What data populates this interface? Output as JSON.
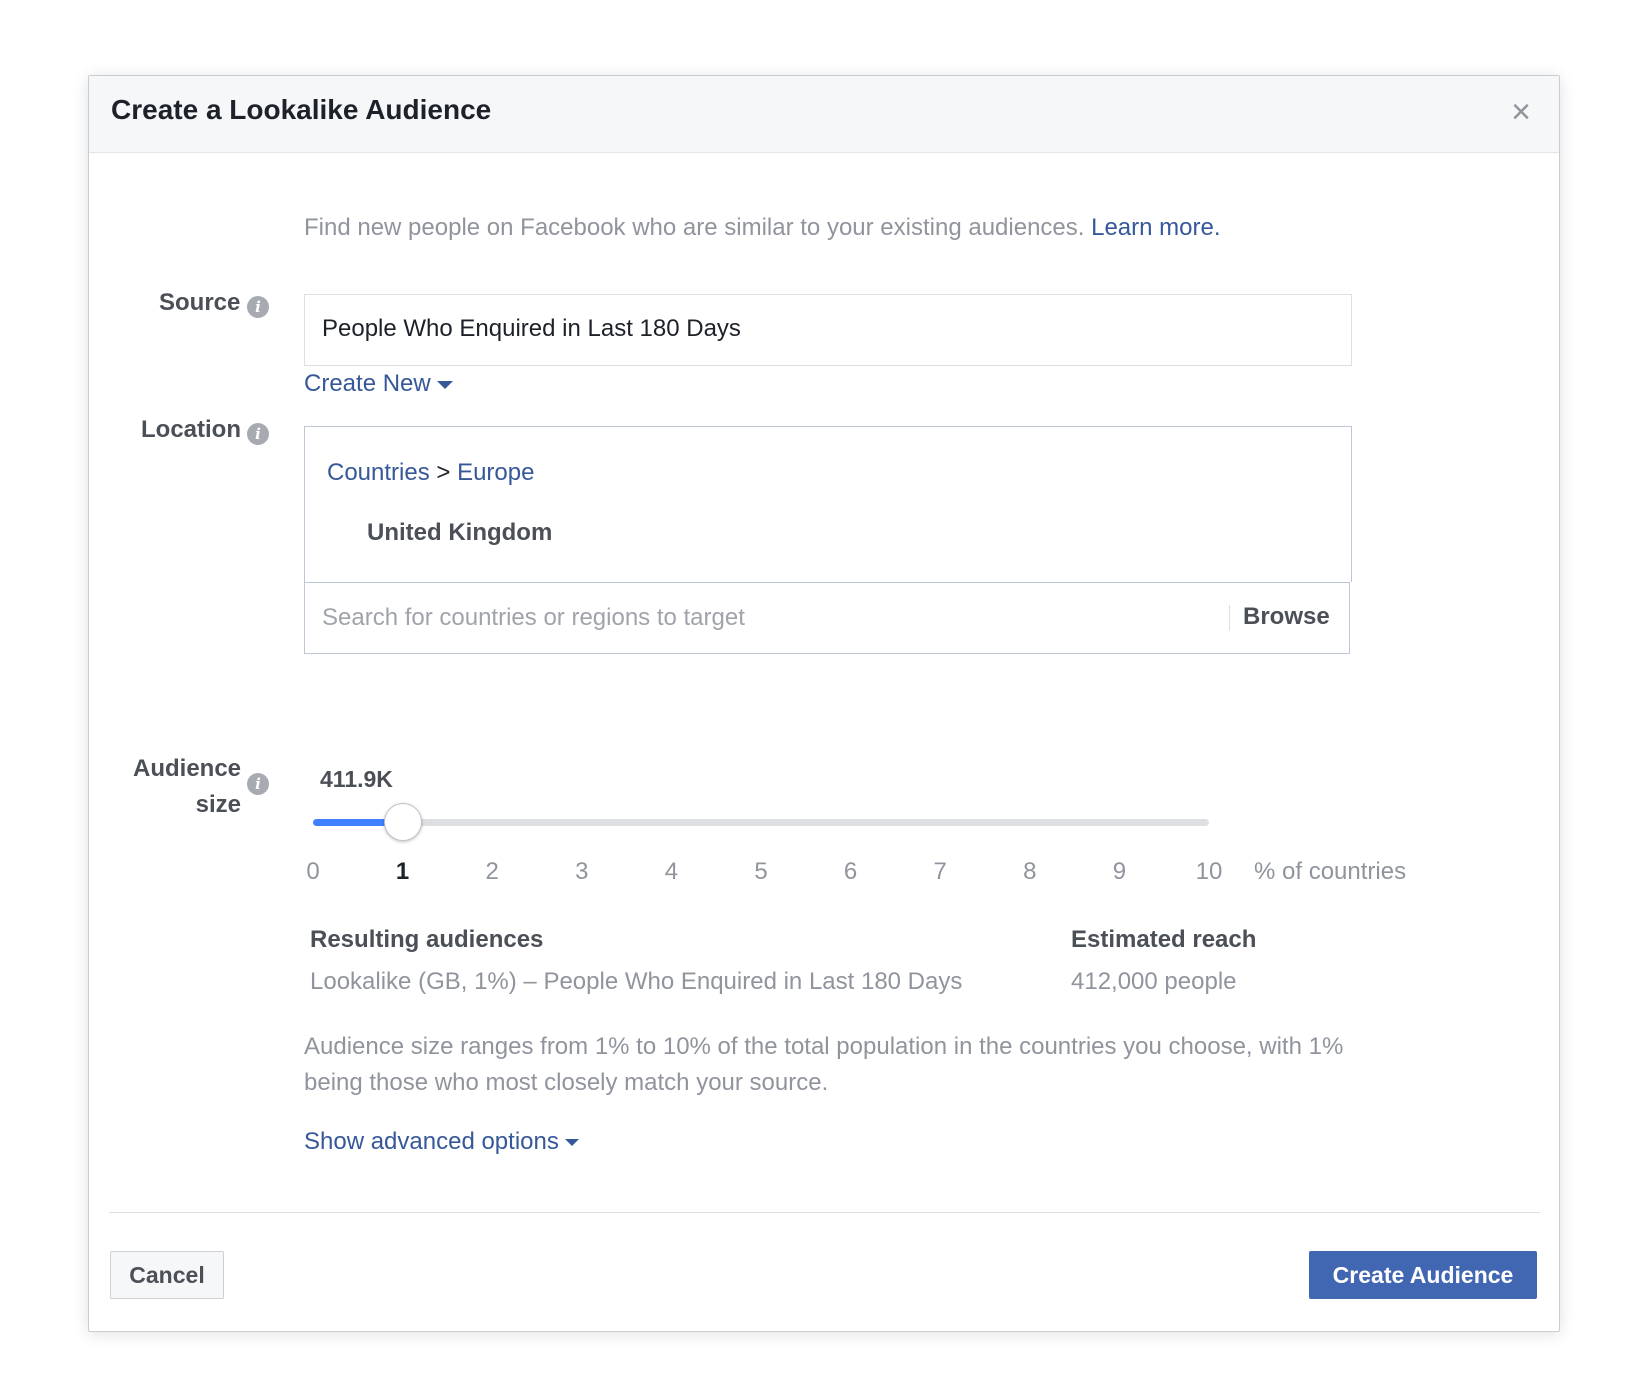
{
  "dialog": {
    "title": "Create a Lookalike Audience",
    "close_symbol": "×",
    "intro_text": "Find new people on Facebook who are similar to your existing audiences.",
    "learn_more": "Learn more."
  },
  "source": {
    "label": "Source",
    "value": "People Who Enquired in Last 180 Days",
    "create_new": "Create New"
  },
  "location": {
    "label": "Location",
    "breadcrumb_countries": "Countries",
    "breadcrumb_separator": ">",
    "breadcrumb_region": "Europe",
    "selected_country": "United Kingdom",
    "search_placeholder": "Search for countries or regions to target",
    "browse_label": "Browse"
  },
  "audience_size": {
    "label_line1": "Audience",
    "label_line2": "size",
    "current_value_display": "411.9K",
    "slider_value": 1,
    "slider_min": 0,
    "slider_max": 10,
    "ticks": [
      "0",
      "1",
      "2",
      "3",
      "4",
      "5",
      "6",
      "7",
      "8",
      "9",
      "10"
    ],
    "unit": "% of countries"
  },
  "results": {
    "resulting_header": "Resulting audiences",
    "resulting_value": "Lookalike (GB, 1%) – People Who Enquired in Last 180 Days",
    "reach_header": "Estimated reach",
    "reach_value": "412,000 people"
  },
  "note": "Audience size ranges from 1% to 10% of the total population in the countries you choose, with 1% being those who most closely match your source.",
  "advanced_options": "Show advanced options",
  "footer": {
    "cancel": "Cancel",
    "create": "Create Audience"
  },
  "colors": {
    "link": "#365899",
    "primary_button": "#4267b2",
    "slider_fill": "#4080ff"
  },
  "icons": {
    "info": "info-icon",
    "close": "close-icon",
    "caret": "caret-down-icon"
  }
}
